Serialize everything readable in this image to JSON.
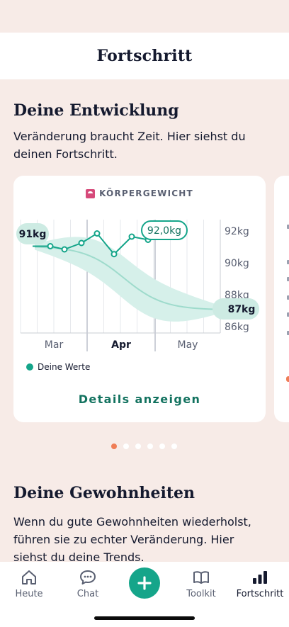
{
  "header": {
    "title": "Fortschritt"
  },
  "progress_section": {
    "title": "Deine Entwicklung",
    "description": "Veränderung braucht Zeit. Hier siehst du deinen Fortschritt."
  },
  "weight_card": {
    "label": "KÖRPERGEWICHT",
    "icon": "scale-icon",
    "start_bubble": "91kg",
    "current_bubble": "92,0kg",
    "goal_bubble": "87kg",
    "legend_label": "Deine Werte",
    "details_button": "Details anzeigen"
  },
  "chart_data": {
    "type": "line",
    "x_labels": [
      "Mar",
      "Apr",
      "May"
    ],
    "bold_x_label": "Apr",
    "y_ticks": [
      "92kg",
      "90kg",
      "88kg",
      "86kg"
    ],
    "ylim": [
      86,
      93
    ],
    "series": [
      {
        "name": "Deine Werte",
        "color": "#15a58a",
        "values": [
          91.0,
          91.0,
          90.8,
          91.2,
          91.8,
          90.5,
          91.6,
          91.4,
          92.0
        ]
      }
    ],
    "trend": {
      "color": "#9edbcc",
      "band_color": "#d6f0ea",
      "start": 91,
      "end": 87
    },
    "grid": true
  },
  "pager": {
    "count": 6,
    "active_index": 0
  },
  "habits_section": {
    "title": "Deine Gewohnheiten",
    "description": "Wenn du gute Gewohnheiten wiederholst, führen sie zu echter Veränderung. Hier siehst du deine Trends."
  },
  "tabbar": {
    "tabs": [
      {
        "label": "Heute",
        "icon": "home-icon"
      },
      {
        "label": "Chat",
        "icon": "chat-icon"
      },
      {
        "label": "",
        "icon": "plus-icon"
      },
      {
        "label": "Toolkit",
        "icon": "book-icon"
      },
      {
        "label": "Fortschritt",
        "icon": "bar-chart-icon"
      }
    ],
    "active_index": 4
  },
  "colors": {
    "background": "#f7ebe7",
    "accent": "#15a58a",
    "pager_active": "#ef7d56",
    "text": "#14192e"
  }
}
